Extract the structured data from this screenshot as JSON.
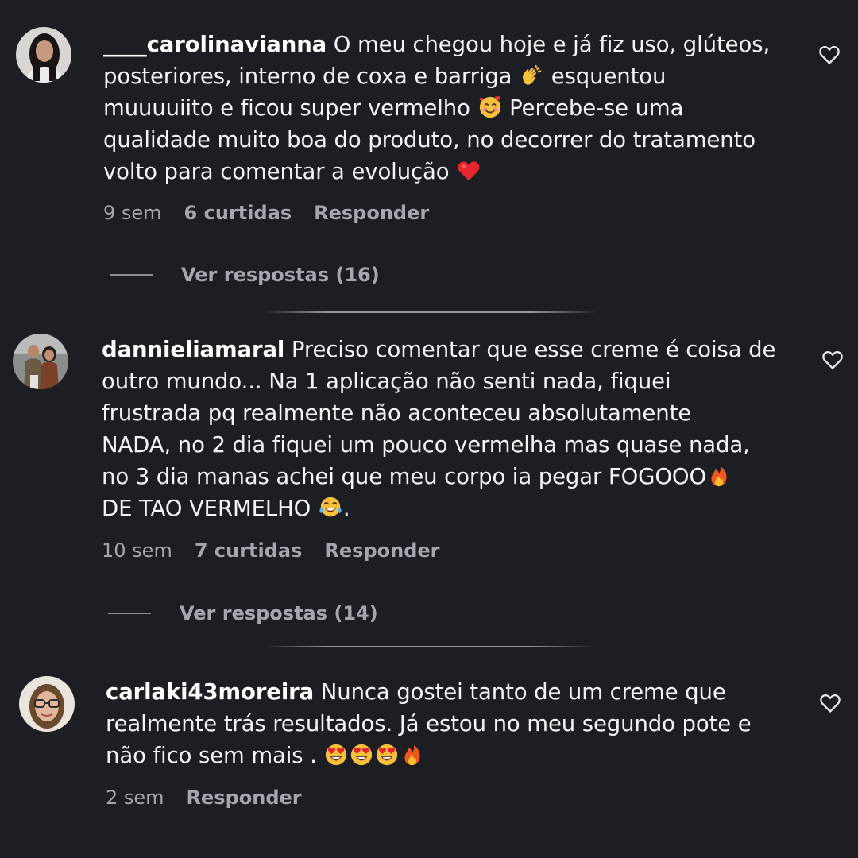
{
  "comments": [
    {
      "username": "____carolinavianna",
      "lines": [
        "O meu chegou hoje e já fiz uso, glúteos,",
        "posteriores, interno de coxa e barriga",
        "esquentou",
        "muuuuiito e ficou super vermelho",
        "Percebe-se uma",
        "qualidade muito boa do produto, no decorrer do tratamento",
        "volto para comentar a evolução"
      ],
      "time": "9 sem",
      "likes": "6 curtidas",
      "reply_label": "Responder",
      "view_replies": "Ver respostas (16)",
      "emojis": [
        "clapping-hands-emoji",
        "smiling-face-with-hearts-emoji",
        "red-heart-emoji"
      ]
    },
    {
      "username": "dannieliamaral",
      "lines": [
        "Preciso comentar que esse creme é coisa de",
        "outro mundo... Na 1 aplicação não senti nada, fiquei",
        "frustrada pq realmente não aconteceu absolutamente",
        "NADA, no 2 dia fiquei um pouco vermelha mas quase nada,",
        "no 3 dia manas achei que meu corpo ia pegar FOGOOO",
        "DE TAO VERMELHO",
        "."
      ],
      "time": "10 sem",
      "likes": "7 curtidas",
      "reply_label": "Responder",
      "view_replies": "Ver respostas (14)",
      "emojis": [
        "fire-emoji",
        "tears-of-joy-emoji"
      ]
    },
    {
      "username": "carlaki43moreira",
      "lines": [
        "Nunca gostei tanto de um creme que",
        "realmente trás resultados. Já estou no meu segundo pote e",
        "não fico sem mais ."
      ],
      "time": "2 sem",
      "reply_label": "Responder",
      "emojis": [
        "heart-eyes-emoji",
        "heart-eyes-emoji",
        "heart-eyes-emoji",
        "fire-emoji"
      ]
    }
  ],
  "colors": {
    "background": "#1d1d24",
    "text": "#f4f4f6",
    "meta": "#a6a7ae"
  },
  "icons": [
    "heart-outline-icon"
  ]
}
